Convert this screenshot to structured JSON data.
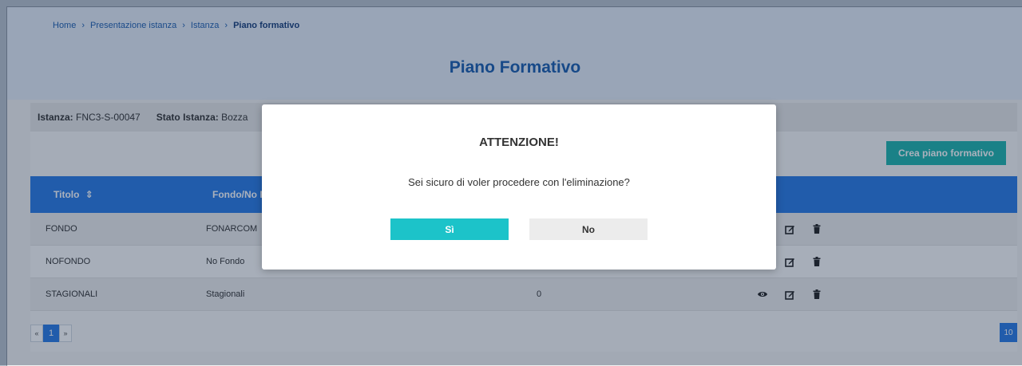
{
  "breadcrumb": {
    "items": [
      "Home",
      "Presentazione istanza",
      "Istanza"
    ],
    "current": "Piano formativo",
    "separator": "›"
  },
  "page": {
    "title": "Piano Formativo"
  },
  "info": {
    "istanza_label": "Istanza:",
    "istanza_value": "FNC3-S-00047",
    "stato_label": "Stato Istanza:",
    "stato_value": "Bozza"
  },
  "actions": {
    "create_label": "Crea piano formativo"
  },
  "table": {
    "headers": {
      "titolo": "Titolo",
      "sort_icon": "⇕",
      "fondo": "Fondo/No F"
    },
    "rows": [
      {
        "titolo": "FONDO",
        "fondo": "FONARCOM",
        "count": ""
      },
      {
        "titolo": "NOFONDO",
        "fondo": "No Fondo",
        "count": ""
      },
      {
        "titolo": "STAGIONALI",
        "fondo": "Stagionali",
        "count": "0"
      }
    ]
  },
  "pagination": {
    "prev": "«",
    "current": "1",
    "next": "»",
    "page_size": "10"
  },
  "modal": {
    "title": "ATTENZIONE!",
    "message": "Sei sicuro di voler procedere con l'eliminazione?",
    "yes_label": "Sì",
    "no_label": "No"
  },
  "colors": {
    "header_bg": "#e5edf7",
    "primary_blue": "#2a7be4",
    "title_blue": "#1a5dae",
    "teal": "#1fb5ad",
    "confirm_cyan": "#1cc3c9"
  },
  "icons": [
    "eye-icon",
    "edit-icon",
    "trash-icon",
    "sort-icon"
  ]
}
